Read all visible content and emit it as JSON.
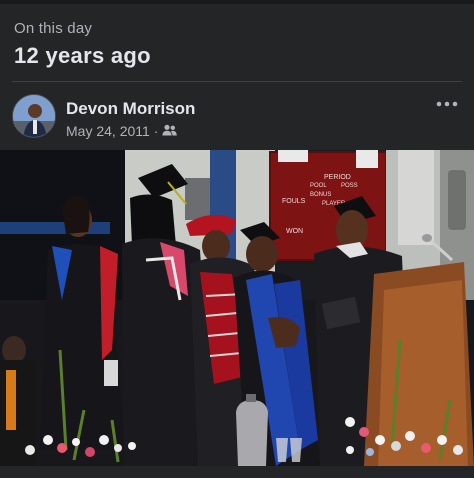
{
  "memory": {
    "eyebrow": "On this day",
    "headline": "12 years ago"
  },
  "post": {
    "author": "Devon Morrison",
    "date": "May 24, 2011",
    "separator": "·",
    "audience_icon": "friends-icon",
    "more_icon": "more-options-icon",
    "photo_text": {
      "sign_period": "PERIOD",
      "sign_fouls": "FOULS",
      "sign_won": "WON",
      "sign_pool": "POOL",
      "sign_bonus": "BONUS",
      "sign_player": "PLAYER",
      "sign_poss": "POSS"
    }
  },
  "colors": {
    "background": "#242526",
    "primary_text": "#e4e6eb",
    "secondary_text": "#b0b3b8",
    "divider": "#3e4042"
  }
}
